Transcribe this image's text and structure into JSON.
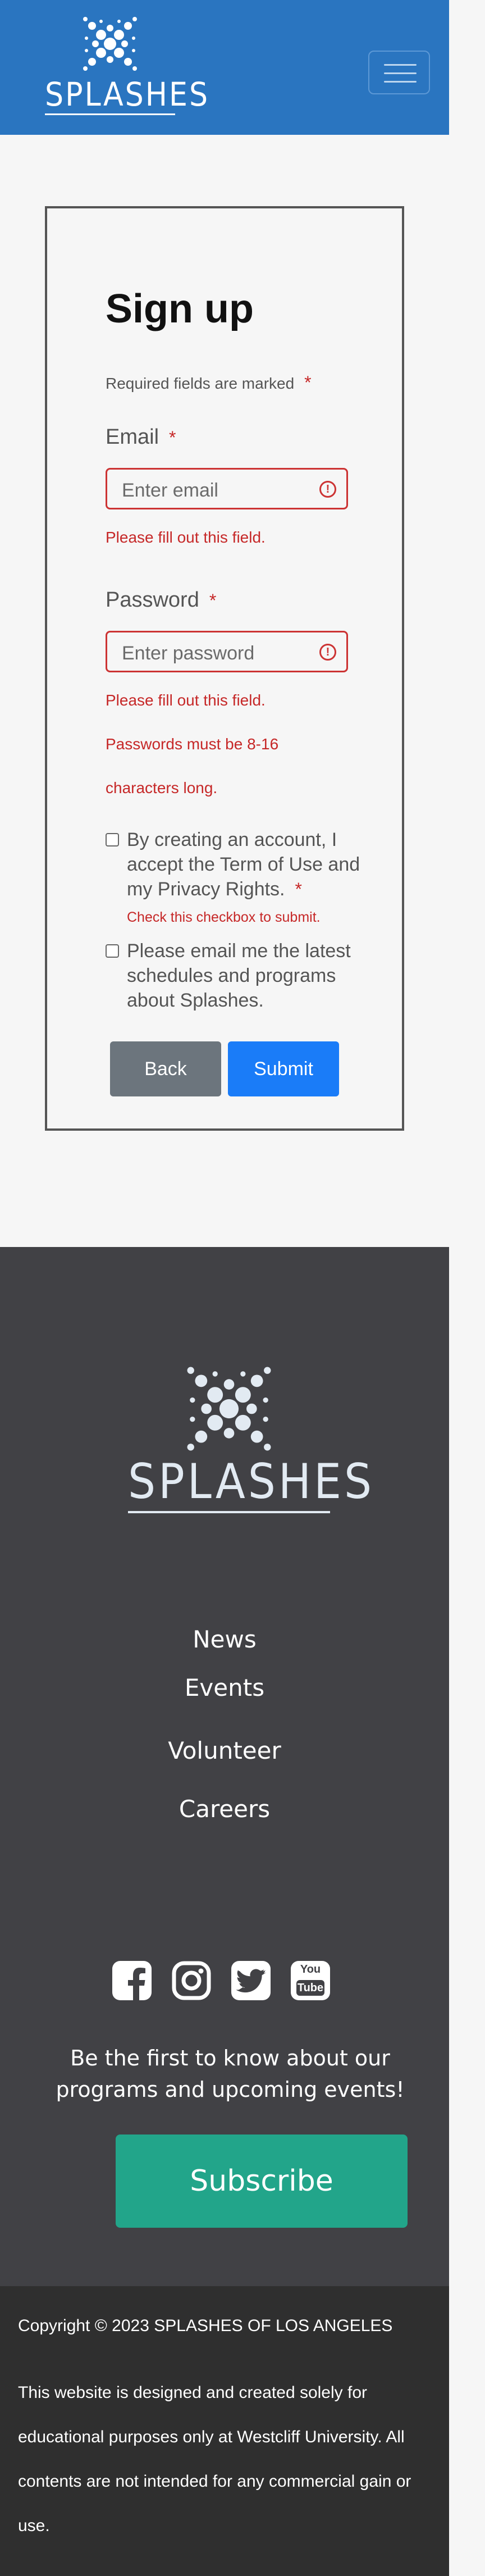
{
  "header": {
    "logo_text": "SPLASHES",
    "menu_icon": "hamburger-icon",
    "background_color": "#2a75c0"
  },
  "form": {
    "title": "Sign up",
    "required_note": "Required fields are marked",
    "required_marker": "*",
    "email": {
      "label": "Email",
      "placeholder": "Enter email",
      "error": "Please fill out this field."
    },
    "password": {
      "label": "Password",
      "placeholder": "Enter password",
      "error": "Please fill out this field.",
      "rule_line1": "Passwords must be 8-16",
      "rule_line2": "characters long."
    },
    "terms": {
      "text": "By creating an account, I accept the Term of Use and my Privacy Rights.",
      "error": "Check this checkbox to submit."
    },
    "newsletter": {
      "text": "Please email me the latest schedules and programs about Splashes."
    },
    "back_label": "Back",
    "submit_label": "Submit",
    "back_color": "#6c757d",
    "submit_color": "#1a7cf8",
    "error_color": "#c62828"
  },
  "footer": {
    "logo_text": "SPLASHES",
    "nav": [
      "News",
      "Events",
      "Volunteer",
      "Careers"
    ],
    "social_icons": [
      "facebook-icon",
      "instagram-icon",
      "twitter-icon",
      "youtube-icon"
    ],
    "youtube_text_top": "You",
    "youtube_text_bottom": "Tube",
    "tagline": "Be the first to know about our programs and upcoming events!",
    "subscribe_label": "Subscribe",
    "subscribe_color": "#22a58a",
    "copyright": "Copyright © 2023 SPLASHES OF LOS ANGELES",
    "disclaimer": "This website is designed and created solely for educational purposes only at Westcliff University. All contents are not intended for any commercial gain or use."
  }
}
